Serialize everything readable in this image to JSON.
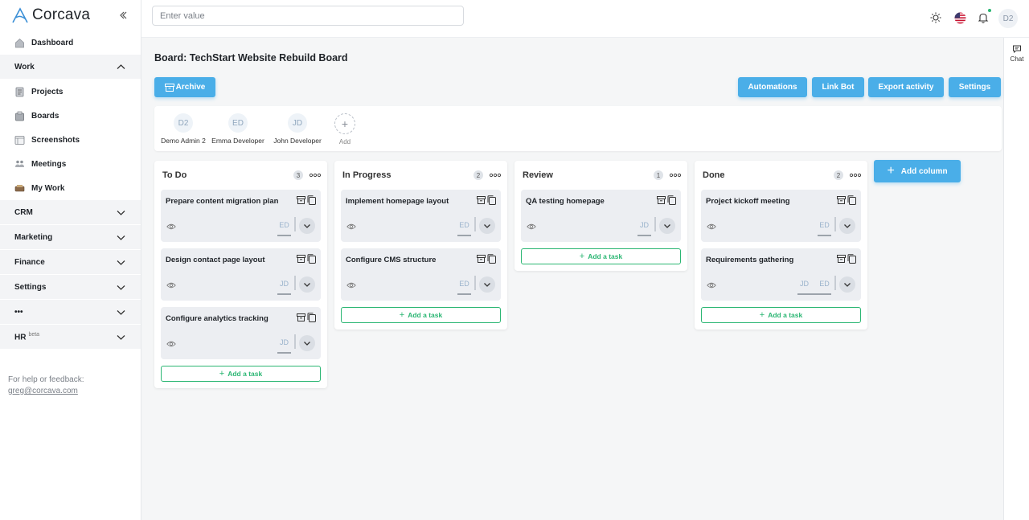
{
  "app": {
    "brand": "Corcava"
  },
  "sidebar": {
    "items": [
      {
        "label": "Dashboard",
        "icon": "dashboard-icon"
      },
      {
        "label": "Work",
        "section": true,
        "open": true
      },
      {
        "label": "Projects",
        "icon": "projects-icon"
      },
      {
        "label": "Boards",
        "icon": "boards-icon"
      },
      {
        "label": "Screenshots",
        "icon": "screenshots-icon"
      },
      {
        "label": "Meetings",
        "icon": "meetings-icon"
      },
      {
        "label": "My Work",
        "icon": "my-work-icon"
      },
      {
        "label": "CRM",
        "section": true
      },
      {
        "label": "Marketing",
        "section": true
      },
      {
        "label": "Finance",
        "section": true
      },
      {
        "label": "Settings",
        "section": true
      },
      {
        "label": "•••",
        "section": true
      },
      {
        "label": "HR",
        "section": true,
        "badge": "beta"
      }
    ],
    "help_text": "For help or feedback:",
    "help_email": "greg@corcava.com"
  },
  "topbar": {
    "search_placeholder": "Enter value",
    "avatar": "D2",
    "icons": [
      "theme-toggle-icon",
      "us-flag-icon",
      "bell-icon"
    ]
  },
  "chat": {
    "label": "Chat"
  },
  "board": {
    "title": "Board: TechStart Website Rebuild Board",
    "archive_label": "Archive",
    "actions": [
      "Automations",
      "Link Bot",
      "Export activity",
      "Settings"
    ],
    "members": [
      {
        "initials": "D2",
        "name": "Demo Admin 2"
      },
      {
        "initials": "ED",
        "name": "Emma Developer"
      },
      {
        "initials": "JD",
        "name": "John Developer"
      }
    ],
    "add_member_label": "Add",
    "add_column_label": "Add column",
    "add_task_label": "Add a task",
    "columns": [
      {
        "title": "To Do",
        "count": "3",
        "cards": [
          {
            "title": "Prepare content migration plan",
            "assignees": [
              "ED"
            ]
          },
          {
            "title": "Design contact page layout",
            "assignees": [
              "JD"
            ]
          },
          {
            "title": "Configure analytics tracking",
            "assignees": [
              "JD"
            ]
          }
        ]
      },
      {
        "title": "In Progress",
        "count": "2",
        "cards": [
          {
            "title": "Implement homepage layout",
            "assignees": [
              "ED"
            ]
          },
          {
            "title": "Configure CMS structure",
            "assignees": [
              "ED"
            ]
          }
        ]
      },
      {
        "title": "Review",
        "count": "1",
        "cards": [
          {
            "title": "QA testing homepage",
            "assignees": [
              "JD"
            ]
          }
        ]
      },
      {
        "title": "Done",
        "count": "2",
        "cards": [
          {
            "title": "Project kickoff meeting",
            "assignees": [
              "ED"
            ]
          },
          {
            "title": "Requirements gathering",
            "assignees": [
              "JD",
              "ED"
            ]
          }
        ]
      }
    ]
  },
  "colors": {
    "accent": "#4aaee8",
    "success": "#2bb673"
  }
}
